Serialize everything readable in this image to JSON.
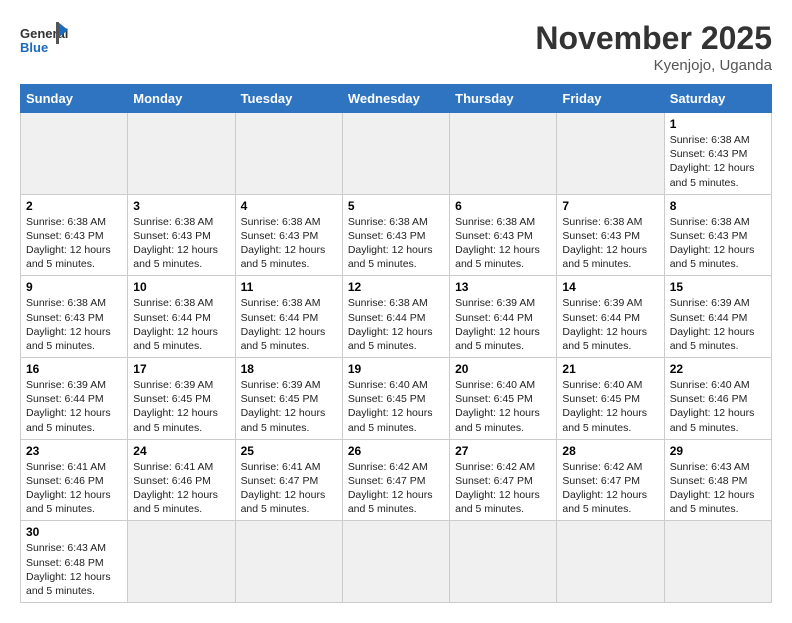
{
  "header": {
    "logo_general": "General",
    "logo_blue": "Blue",
    "month_title": "November 2025",
    "location": "Kyenjojo, Uganda"
  },
  "weekdays": [
    "Sunday",
    "Monday",
    "Tuesday",
    "Wednesday",
    "Thursday",
    "Friday",
    "Saturday"
  ],
  "weeks": [
    [
      {
        "day": "",
        "info": ""
      },
      {
        "day": "",
        "info": ""
      },
      {
        "day": "",
        "info": ""
      },
      {
        "day": "",
        "info": ""
      },
      {
        "day": "",
        "info": ""
      },
      {
        "day": "",
        "info": ""
      },
      {
        "day": "1",
        "info": "Sunrise: 6:38 AM\nSunset: 6:43 PM\nDaylight: 12 hours\nand 5 minutes."
      }
    ],
    [
      {
        "day": "2",
        "info": "Sunrise: 6:38 AM\nSunset: 6:43 PM\nDaylight: 12 hours\nand 5 minutes."
      },
      {
        "day": "3",
        "info": "Sunrise: 6:38 AM\nSunset: 6:43 PM\nDaylight: 12 hours\nand 5 minutes."
      },
      {
        "day": "4",
        "info": "Sunrise: 6:38 AM\nSunset: 6:43 PM\nDaylight: 12 hours\nand 5 minutes."
      },
      {
        "day": "5",
        "info": "Sunrise: 6:38 AM\nSunset: 6:43 PM\nDaylight: 12 hours\nand 5 minutes."
      },
      {
        "day": "6",
        "info": "Sunrise: 6:38 AM\nSunset: 6:43 PM\nDaylight: 12 hours\nand 5 minutes."
      },
      {
        "day": "7",
        "info": "Sunrise: 6:38 AM\nSunset: 6:43 PM\nDaylight: 12 hours\nand 5 minutes."
      },
      {
        "day": "8",
        "info": "Sunrise: 6:38 AM\nSunset: 6:43 PM\nDaylight: 12 hours\nand 5 minutes."
      }
    ],
    [
      {
        "day": "9",
        "info": "Sunrise: 6:38 AM\nSunset: 6:43 PM\nDaylight: 12 hours\nand 5 minutes."
      },
      {
        "day": "10",
        "info": "Sunrise: 6:38 AM\nSunset: 6:44 PM\nDaylight: 12 hours\nand 5 minutes."
      },
      {
        "day": "11",
        "info": "Sunrise: 6:38 AM\nSunset: 6:44 PM\nDaylight: 12 hours\nand 5 minutes."
      },
      {
        "day": "12",
        "info": "Sunrise: 6:38 AM\nSunset: 6:44 PM\nDaylight: 12 hours\nand 5 minutes."
      },
      {
        "day": "13",
        "info": "Sunrise: 6:39 AM\nSunset: 6:44 PM\nDaylight: 12 hours\nand 5 minutes."
      },
      {
        "day": "14",
        "info": "Sunrise: 6:39 AM\nSunset: 6:44 PM\nDaylight: 12 hours\nand 5 minutes."
      },
      {
        "day": "15",
        "info": "Sunrise: 6:39 AM\nSunset: 6:44 PM\nDaylight: 12 hours\nand 5 minutes."
      }
    ],
    [
      {
        "day": "16",
        "info": "Sunrise: 6:39 AM\nSunset: 6:44 PM\nDaylight: 12 hours\nand 5 minutes."
      },
      {
        "day": "17",
        "info": "Sunrise: 6:39 AM\nSunset: 6:45 PM\nDaylight: 12 hours\nand 5 minutes."
      },
      {
        "day": "18",
        "info": "Sunrise: 6:39 AM\nSunset: 6:45 PM\nDaylight: 12 hours\nand 5 minutes."
      },
      {
        "day": "19",
        "info": "Sunrise: 6:40 AM\nSunset: 6:45 PM\nDaylight: 12 hours\nand 5 minutes."
      },
      {
        "day": "20",
        "info": "Sunrise: 6:40 AM\nSunset: 6:45 PM\nDaylight: 12 hours\nand 5 minutes."
      },
      {
        "day": "21",
        "info": "Sunrise: 6:40 AM\nSunset: 6:45 PM\nDaylight: 12 hours\nand 5 minutes."
      },
      {
        "day": "22",
        "info": "Sunrise: 6:40 AM\nSunset: 6:46 PM\nDaylight: 12 hours\nand 5 minutes."
      }
    ],
    [
      {
        "day": "23",
        "info": "Sunrise: 6:41 AM\nSunset: 6:46 PM\nDaylight: 12 hours\nand 5 minutes."
      },
      {
        "day": "24",
        "info": "Sunrise: 6:41 AM\nSunset: 6:46 PM\nDaylight: 12 hours\nand 5 minutes."
      },
      {
        "day": "25",
        "info": "Sunrise: 6:41 AM\nSunset: 6:47 PM\nDaylight: 12 hours\nand 5 minutes."
      },
      {
        "day": "26",
        "info": "Sunrise: 6:42 AM\nSunset: 6:47 PM\nDaylight: 12 hours\nand 5 minutes."
      },
      {
        "day": "27",
        "info": "Sunrise: 6:42 AM\nSunset: 6:47 PM\nDaylight: 12 hours\nand 5 minutes."
      },
      {
        "day": "28",
        "info": "Sunrise: 6:42 AM\nSunset: 6:47 PM\nDaylight: 12 hours\nand 5 minutes."
      },
      {
        "day": "29",
        "info": "Sunrise: 6:43 AM\nSunset: 6:48 PM\nDaylight: 12 hours\nand 5 minutes."
      }
    ],
    [
      {
        "day": "30",
        "info": "Sunrise: 6:43 AM\nSunset: 6:48 PM\nDaylight: 12 hours\nand 5 minutes."
      },
      {
        "day": "",
        "info": ""
      },
      {
        "day": "",
        "info": ""
      },
      {
        "day": "",
        "info": ""
      },
      {
        "day": "",
        "info": ""
      },
      {
        "day": "",
        "info": ""
      },
      {
        "day": "",
        "info": ""
      }
    ]
  ]
}
